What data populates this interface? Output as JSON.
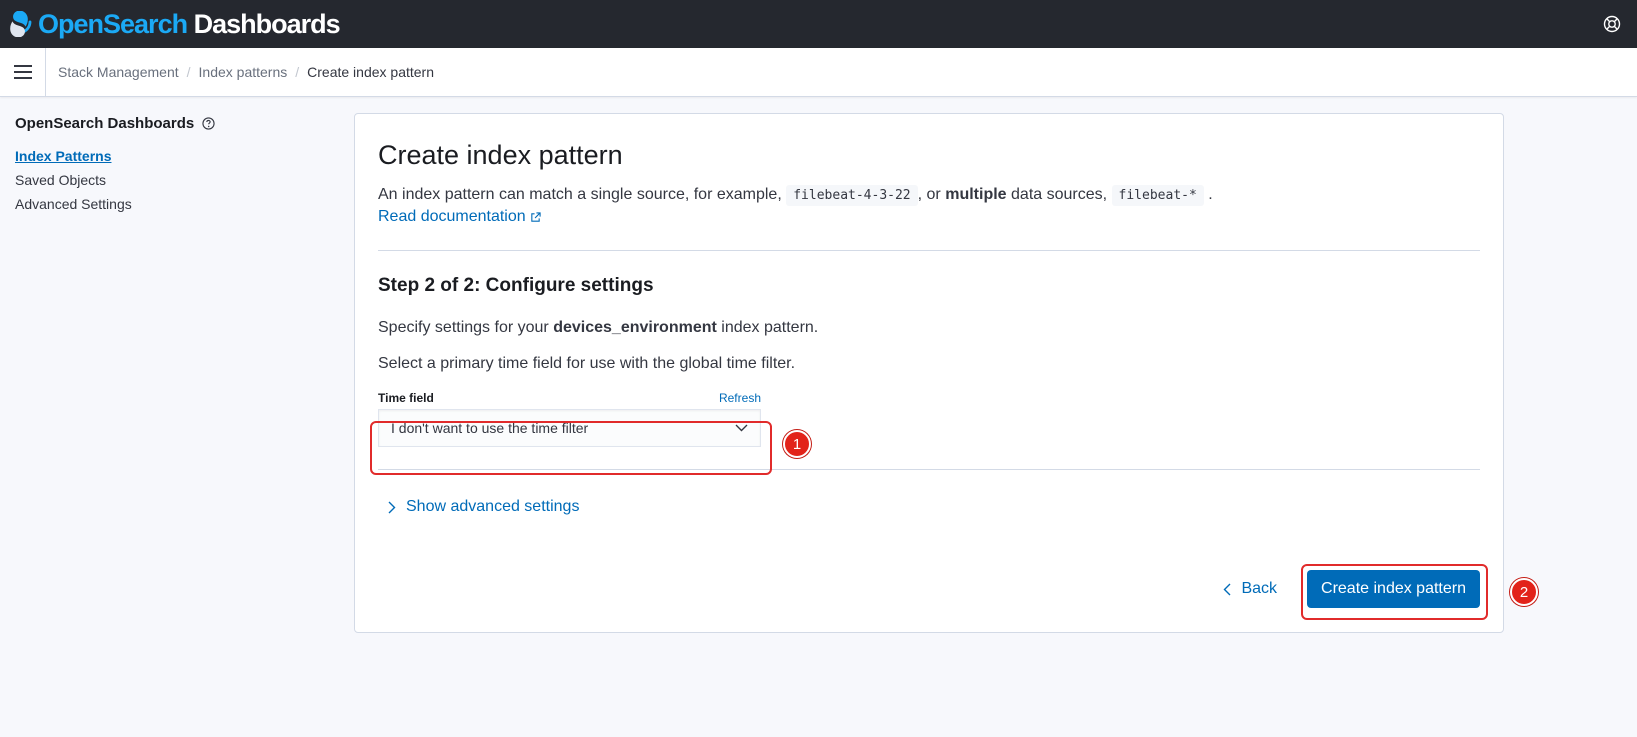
{
  "header": {
    "brand_open": "Open",
    "brand_search": "Search",
    "brand_dash": " Dashboards",
    "help_icon": "help-lifebuoy-icon"
  },
  "breadcrumbs": [
    "Stack Management",
    "Index patterns",
    "Create index pattern"
  ],
  "sidenav": {
    "title": "OpenSearch Dashboards",
    "items": [
      {
        "label": "Index Patterns",
        "active": true
      },
      {
        "label": "Saved Objects",
        "active": false
      },
      {
        "label": "Advanced Settings",
        "active": false
      }
    ]
  },
  "main": {
    "title": "Create index pattern",
    "desc_part1": "An index pattern can match a single source, for example,",
    "code1": "filebeat-4-3-22",
    "desc_part2": ", or",
    "desc_bold": "multiple",
    "desc_part3": "data sources,",
    "code2": "filebeat-*",
    "desc_part4": ".",
    "doc_link": "Read documentation",
    "step_title": "Step 2 of 2: Configure settings",
    "specify_pre": "Specify settings for your",
    "index_name": "devices_environment",
    "specify_post": "index pattern.",
    "select_text": "Select a primary time field for use with the global time filter.",
    "time_field_label": "Time field",
    "refresh_label": "Refresh",
    "time_field_value": "I don't want to use the time filter",
    "advanced_toggle": "Show advanced settings",
    "back_label": "Back",
    "create_label": "Create index pattern"
  },
  "annotations": {
    "badge1": "1",
    "badge2": "2"
  },
  "colors": {
    "accent": "#006bb8",
    "header_bg": "#25282f",
    "annotation": "#e2231a"
  }
}
